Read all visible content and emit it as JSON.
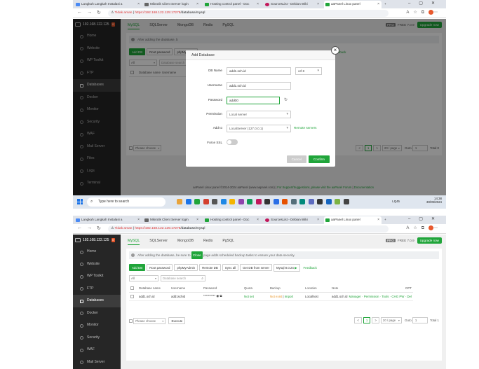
{
  "browser": {
    "tabs": [
      {
        "label": "Langkah Langkah Instalasi a",
        "color": "#4a8af4"
      },
      {
        "label": "Mikrotik Client Server login",
        "color": "#666666"
      },
      {
        "label": "Hosting control panel - Doc",
        "color": "#20a53a"
      },
      {
        "label": "SourcesList - Debian Wiki",
        "color": "#c2185b"
      },
      {
        "label": "aaPanel Linux panel",
        "color": "#20a53a"
      }
    ],
    "not_secure": "Tidak aman",
    "url_host": "https://192.168.122.125:17278",
    "url_path": "/database/mysql"
  },
  "sidebar": {
    "server": "192.168.122.125",
    "badge": "0",
    "items": [
      "Home",
      "Website",
      "WP Toolkit",
      "FTP",
      "Databases",
      "Docker",
      "Monitor",
      "Security",
      "WAF",
      "Mail Server",
      "Files",
      "Logs",
      "Terminal"
    ]
  },
  "db_tabs": [
    "MySQL",
    "SQLServer",
    "MongoDB",
    "Redis",
    "PgSQL"
  ],
  "topright": {
    "pro": "PRO",
    "free": "FREE",
    "version": "7.0.9",
    "upgrade": "Upgrade now"
  },
  "notice": {
    "pre": "After adding the database, be sure to",
    "tag": "Close",
    "post": "page adds scheduled backup tasks to ensure your data security."
  },
  "notice_short": "After adding the database, b",
  "buttons": [
    "Add DB",
    "Root password",
    "phpMyAdmin",
    "Remote DB",
    "Sync all",
    "Get DB from server"
  ],
  "mysql_version": "Mysql 8.0.24",
  "feedback": "Feedback",
  "filter_all": "All",
  "search_placeholder": "Database search",
  "columns": [
    "Database name",
    "Username",
    "Password",
    "Quota",
    "Backup",
    "Location",
    "Note",
    "OPT"
  ],
  "row": {
    "name": "add1.sch.id",
    "user": "add1schid",
    "password": "**********",
    "quota": "Not set",
    "backup_a": "Not exist",
    "backup_b": "Import",
    "location": "Localhost",
    "note": "add1.sch.id",
    "ops": "Manager · Permission · Tools · CHG PW · Del"
  },
  "batch_placeholder": "Please choose",
  "execute": "Execute",
  "pagination": {
    "page": "1",
    "per_page": "20 / page",
    "goto": "Goto",
    "goto_val": "1",
    "total": "Total 1",
    "total_empty": "Total 0",
    "prev": "<",
    "next": ">"
  },
  "footer": {
    "copy": "aaPanel Linux panel ©2014-2024 aaPanel (www.aapanel.com)",
    "support": "For Support/Suggestions, please visit the aaPanel Forum",
    "docs": "Documentation"
  },
  "dialog": {
    "title": "Add Database",
    "db_name_label": "DB Name",
    "db_name": "add1.sch.id",
    "charset": "utf-8",
    "username_label": "Username",
    "username": "add1.sch.id",
    "password_label": "Password",
    "password": "add00",
    "permission_label": "Permission",
    "permission": "Local server",
    "add_to_label": "Add to",
    "add_to": "LocalServer (127.0.0.1)",
    "remote_link": "Remote servers",
    "force_ssl_label": "Force SSL",
    "cancel": "Cancel",
    "confirm": "Confirm"
  },
  "taskbar": {
    "search": "Type here to search",
    "weather": "LQ45",
    "time": "14:38",
    "date": "30/09/2024",
    "app_colors": [
      "#e8a33a",
      "#1a73e8",
      "#20a53a",
      "#d33f2f",
      "#555555",
      "#1e88e5",
      "#f4b400",
      "#8e44ad",
      "#0f9d58",
      "#c2185b",
      "#333333",
      "#2a6ee6",
      "#e65100",
      "#546e7a",
      "#00897b",
      "#5c6bc0",
      "#333333",
      "#1565c0",
      "#7cb342",
      "#444444"
    ]
  }
}
